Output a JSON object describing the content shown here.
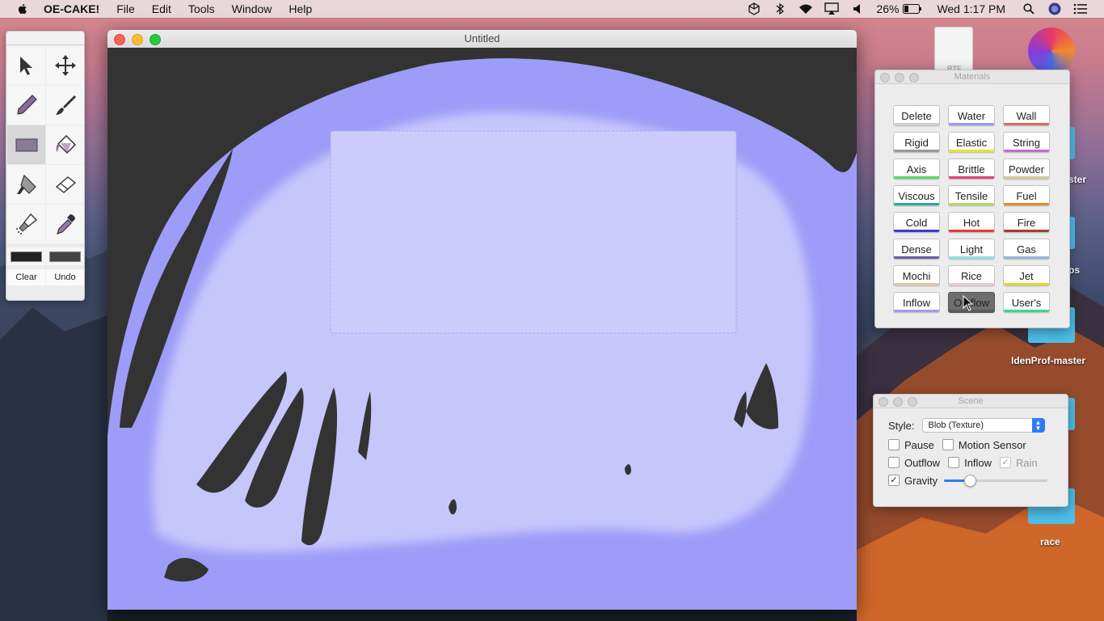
{
  "menubar": {
    "app_name": "OE-CAKE!",
    "menus": [
      "File",
      "Edit",
      "Tools",
      "Window",
      "Help"
    ],
    "battery": "26%",
    "clock": "Wed 1:17 PM"
  },
  "window": {
    "title": "Untitled"
  },
  "tools": {
    "buttons": [
      "Clear",
      "Undo"
    ],
    "colors": {
      "primary": "#222222",
      "secondary": "#444444"
    }
  },
  "materials": {
    "title": "Materials",
    "items": [
      {
        "label": "Delete",
        "color": "#ffffff"
      },
      {
        "label": "Water",
        "color": "#9a9af5"
      },
      {
        "label": "Wall",
        "color": "#d96a6a"
      },
      {
        "label": "Rigid",
        "color": "#9a9a9a"
      },
      {
        "label": "Elastic",
        "color": "#e6e62a"
      },
      {
        "label": "String",
        "color": "#c66ad6"
      },
      {
        "label": "Axis",
        "color": "#5bd66a"
      },
      {
        "label": "Brittle",
        "color": "#e0427a"
      },
      {
        "label": "Powder",
        "color": "#d4c9a4"
      },
      {
        "label": "Viscous",
        "color": "#2aa6a6"
      },
      {
        "label": "Tensile",
        "color": "#b8d66a"
      },
      {
        "label": "Fuel",
        "color": "#e68a2a"
      },
      {
        "label": "Cold",
        "color": "#3a3ad6"
      },
      {
        "label": "Hot",
        "color": "#e63a3a"
      },
      {
        "label": "Fire",
        "color": "#a83a3a"
      },
      {
        "label": "Dense",
        "color": "#6a5aa6"
      },
      {
        "label": "Light",
        "color": "#8ae6e0"
      },
      {
        "label": "Gas",
        "color": "#9ab4d6"
      },
      {
        "label": "Mochi",
        "color": "#e6c4a4"
      },
      {
        "label": "Rice",
        "color": "#f2c4cc"
      },
      {
        "label": "Jet",
        "color": "#e6d62a"
      },
      {
        "label": "Inflow",
        "color": "#a49af0"
      },
      {
        "label": "Outflow",
        "color": "#5a5a5a"
      },
      {
        "label": "User's",
        "color": "#3ad68a"
      }
    ],
    "selected": "Outflow"
  },
  "scene": {
    "title": "Scene",
    "style_label": "Style:",
    "style_value": "Blob (Texture)",
    "checkboxes": {
      "pause": {
        "label": "Pause",
        "checked": false
      },
      "motion_sensor": {
        "label": "Motion Sensor",
        "checked": false
      },
      "outflow": {
        "label": "Outflow",
        "checked": false
      },
      "inflow": {
        "label": "Inflow",
        "checked": false
      },
      "rain": {
        "label": "Rain",
        "checked": true
      },
      "gravity": {
        "label": "Gravity",
        "checked": true
      }
    },
    "gravity_level": 0.22
  },
  "desktop": {
    "labels": [
      "ster",
      "ps",
      "IdenProf-master",
      "race"
    ],
    "file_badge": "RTF"
  },
  "colors": {
    "fluid": "#9d9cf8",
    "fluid_light": "#c9c8fb",
    "accent": "#2d7cf6"
  }
}
